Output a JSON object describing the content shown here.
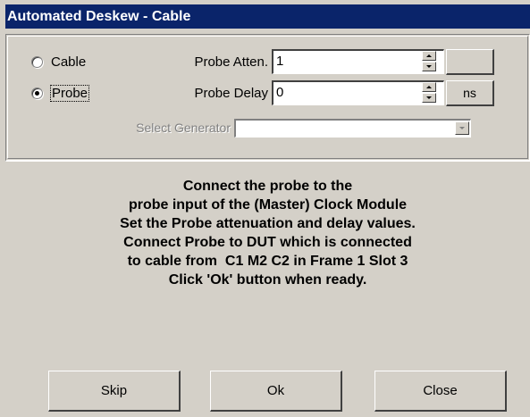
{
  "window": {
    "title": "Automated Deskew - Cable"
  },
  "mode": {
    "options": [
      {
        "label": "Cable",
        "checked": false
      },
      {
        "label": "Probe",
        "checked": true
      }
    ]
  },
  "probe_atten": {
    "label": "Probe Atten.",
    "value": "1",
    "unit": ""
  },
  "probe_delay": {
    "label": "Probe Delay",
    "value": "0",
    "unit": "ns"
  },
  "generator": {
    "label": "Select Generator",
    "value": ""
  },
  "message": {
    "lines": [
      "Connect the probe to the",
      "probe input of the (Master) Clock Module",
      "Set the Probe attenuation and delay values.",
      "Connect Probe to DUT which is connected",
      "to cable from  C1 M2 C2 in Frame 1 Slot 3",
      "Click 'Ok' button when ready."
    ]
  },
  "buttons": {
    "skip": "Skip",
    "ok": "Ok",
    "close": "Close"
  },
  "colors": {
    "titlebar": "#0a246a",
    "face": "#d4d0c8"
  }
}
